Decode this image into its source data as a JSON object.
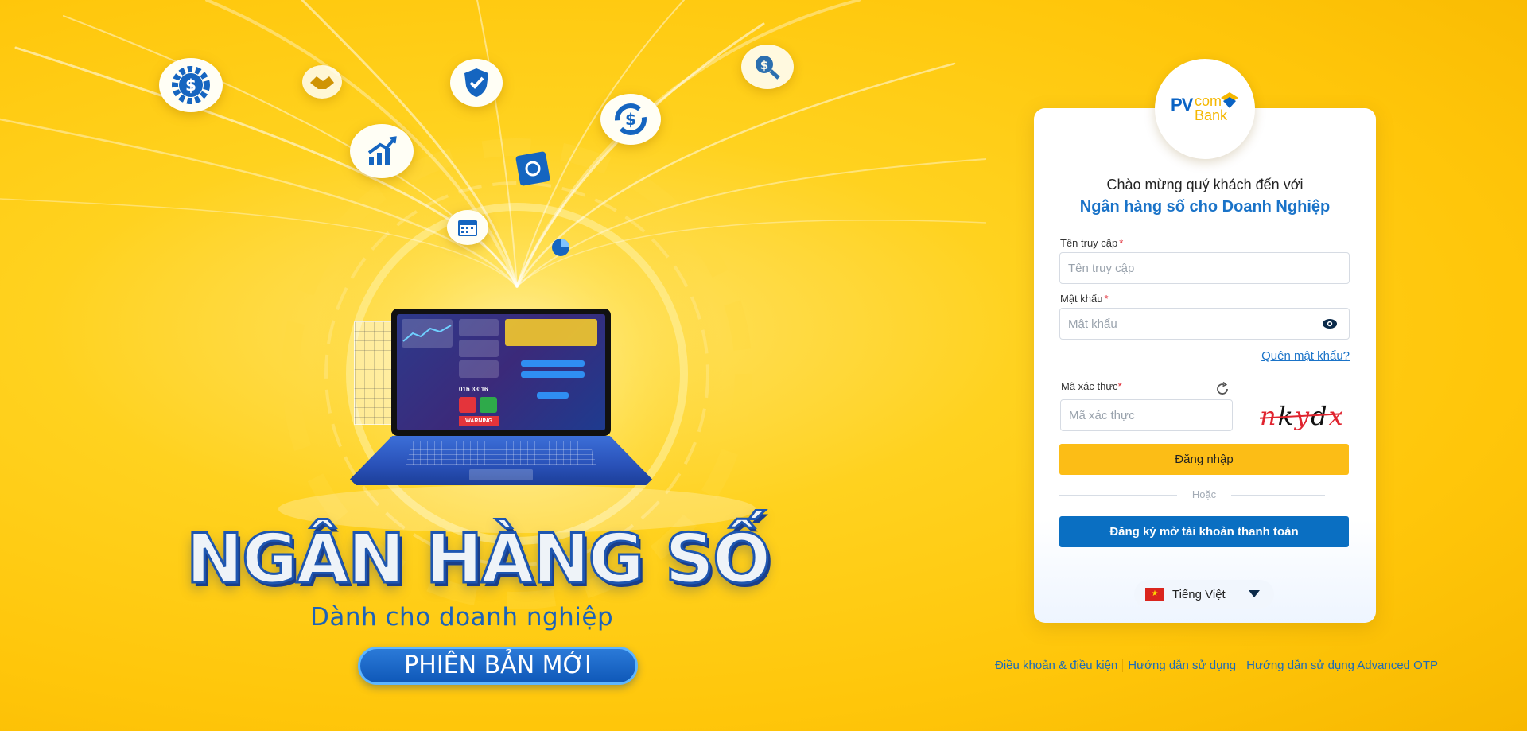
{
  "hero": {
    "title": "NGÂN HÀNG SỐ",
    "subtitle": "Dành cho doanh nghiệp",
    "badge": "PHIÊN BẢN MỚI",
    "laptop_timer": "01h 33:16",
    "laptop_warning": "WARNING"
  },
  "logo": {
    "pv": "PV",
    "com": "com",
    "bank": "Bank"
  },
  "login": {
    "welcome": "Chào mừng quý khách đến với",
    "bank_name": "Ngân hàng số cho Doanh Nghiệp",
    "username_label": "Tên truy cập",
    "username_placeholder": "Tên truy cập",
    "password_label": "Mật khẩu",
    "password_placeholder": "Mật khẩu",
    "forgot": "Quên mật khẩu?",
    "captcha_label": "Mã xác thực",
    "captcha_placeholder": "Mã xác thực",
    "captcha_chars": [
      "n",
      "k",
      "y",
      "d",
      "x"
    ],
    "required_mark": "*",
    "login_button": "Đăng nhập",
    "or": "Hoặc",
    "register_button": "Đăng ký mở tài khoản thanh toán"
  },
  "language": {
    "selected": "Tiếng Việt",
    "flag_star": "★"
  },
  "footer": {
    "links": [
      "Điều khoản & điều kiện",
      "Hướng dẫn sử dụng",
      "Hướng dẫn sử dụng Advanced OTP"
    ]
  },
  "colors": {
    "brand_blue": "#0a6fc2",
    "brand_yellow": "#fcbd16",
    "required_red": "#e0242f"
  }
}
